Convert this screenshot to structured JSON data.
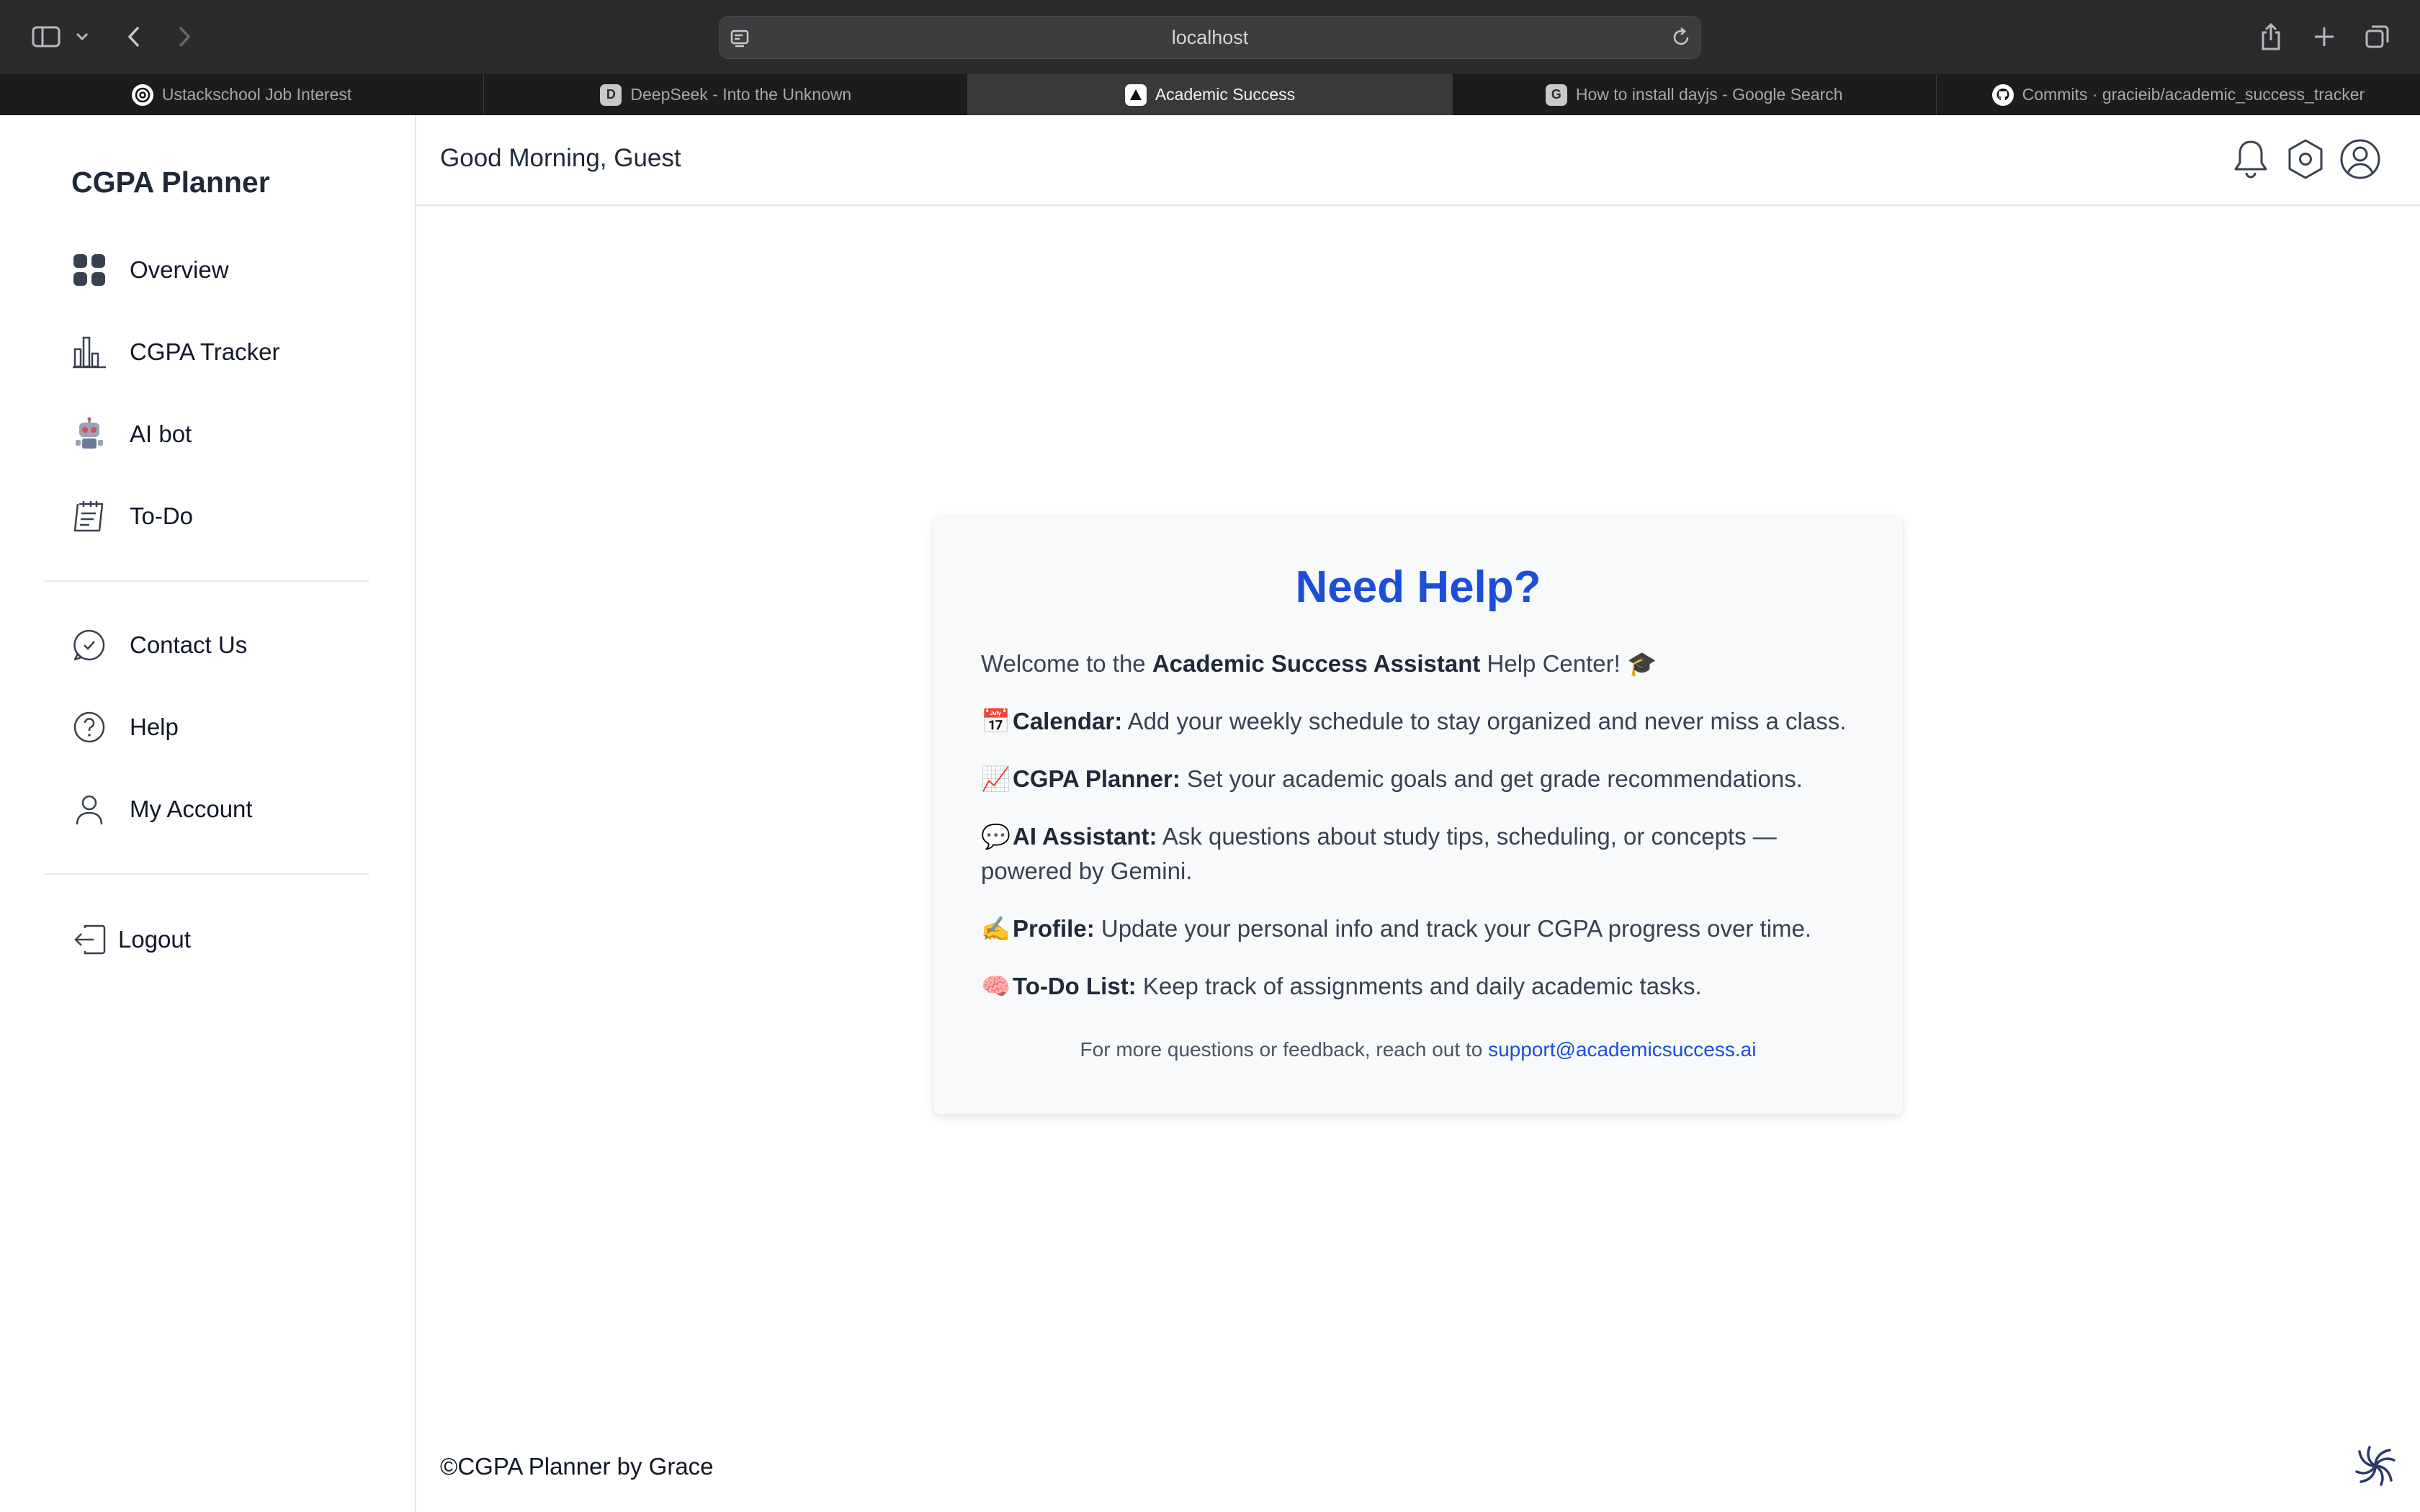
{
  "browser": {
    "url": "localhost",
    "tabs": [
      {
        "label": "Ustackschool Job Interest",
        "favicon": "openai-icon"
      },
      {
        "label": "DeepSeek - Into the Unknown",
        "favicon": "D"
      },
      {
        "label": "Academic Success",
        "favicon": "app-icon",
        "active": true
      },
      {
        "label": "How to install dayjs - Google Search",
        "favicon": "G"
      },
      {
        "label": "Commits · gracieib/academic_success_tracker",
        "favicon": "github-icon"
      }
    ]
  },
  "sidebar": {
    "brand": "CGPA Planner",
    "primary": [
      {
        "label": "Overview",
        "icon": "grid-icon"
      },
      {
        "label": "CGPA Tracker",
        "icon": "bar-chart-icon"
      },
      {
        "label": "AI bot",
        "icon": "robot-icon"
      },
      {
        "label": "To-Do",
        "icon": "todo-icon"
      }
    ],
    "secondary": [
      {
        "label": "Contact Us",
        "icon": "chat-check-icon"
      },
      {
        "label": "Help",
        "icon": "question-icon"
      },
      {
        "label": "My Account",
        "icon": "user-icon"
      }
    ],
    "logout": {
      "label": "Logout",
      "icon": "logout-icon"
    }
  },
  "header": {
    "greeting": "Good Morning, Guest",
    "icons": [
      "bell-icon",
      "settings-icon",
      "profile-icon"
    ]
  },
  "help": {
    "title": "Need Help?",
    "welcome_pre": "Welcome to the ",
    "welcome_bold": "Academic Success Assistant",
    "welcome_post": " Help Center! 🎓",
    "items": [
      {
        "emoji": "📅",
        "title": "Calendar:",
        "text": " Add your weekly schedule to stay organized and never miss a class."
      },
      {
        "emoji": "📈",
        "title": "CGPA Planner:",
        "text": " Set your academic goals and get grade recommendations."
      },
      {
        "emoji": "💬",
        "title": "AI Assistant:",
        "text": " Ask questions about study tips, scheduling, or concepts — powered by Gemini."
      },
      {
        "emoji": "✍️",
        "title": "Profile:",
        "text": " Update your personal info and track your CGPA progress over time."
      },
      {
        "emoji": "🧠",
        "title": "To-Do List:",
        "text": " Keep track of assignments and daily academic tasks."
      }
    ],
    "footer_text": "For more questions or feedback, reach out to ",
    "support_email": "support@academicsuccess.ai"
  },
  "footer": {
    "copyright": "©CGPA Planner by Grace"
  }
}
